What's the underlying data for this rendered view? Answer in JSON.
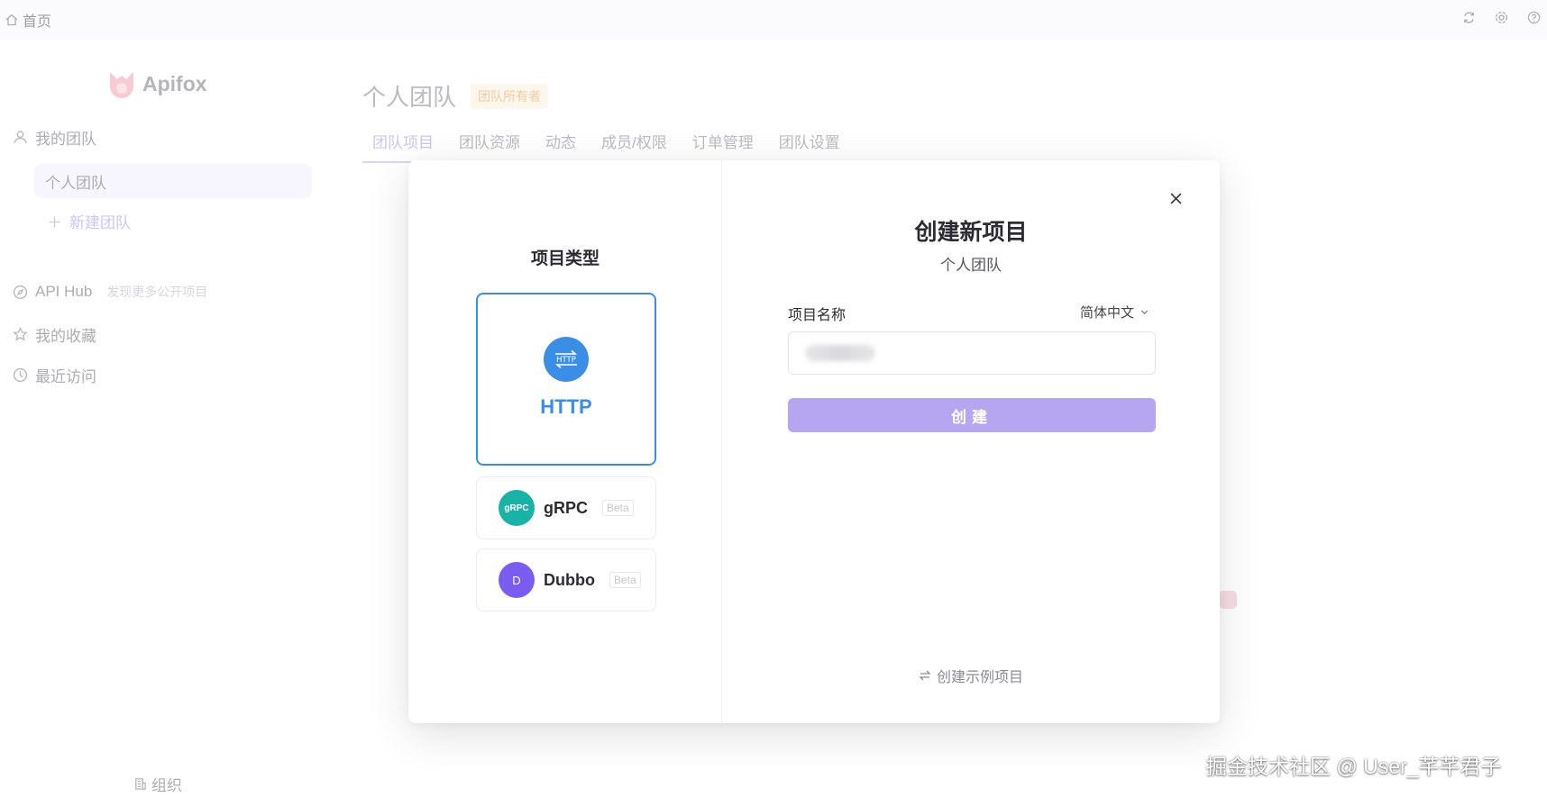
{
  "topbar": {
    "home_label": "首页",
    "icons": [
      "home-icon",
      "refresh-icon",
      "gear-icon",
      "help-icon"
    ]
  },
  "sidebar": {
    "logo_text": "Apifox",
    "my_team": "我的团队",
    "personal_team": "个人团队",
    "new_team": "新建团队",
    "api_hub": "API Hub",
    "api_hub_hint": "发现更多公开项目",
    "favorites": "我的收藏",
    "recent": "最近访问",
    "org": "组织"
  },
  "main": {
    "team_title": "个人团队",
    "owner_badge": "团队所有者",
    "tabs": [
      {
        "label": "团队项目",
        "active": true
      },
      {
        "label": "团队资源",
        "active": false
      },
      {
        "label": "动态",
        "active": false
      },
      {
        "label": "成员/权限",
        "active": false
      },
      {
        "label": "订单管理",
        "active": false
      },
      {
        "label": "团队设置",
        "active": false
      }
    ]
  },
  "modal": {
    "type_title": "项目类型",
    "types": [
      {
        "name": "HTTP",
        "icon_text": "HTTP",
        "selected": true
      },
      {
        "name": "gRPC",
        "icon_text": "gRPC",
        "beta": "Beta"
      },
      {
        "name": "Dubbo",
        "icon_text": "D",
        "beta": "Beta"
      }
    ],
    "title": "创建新项目",
    "subtitle": "个人团队",
    "name_label": "项目名称",
    "language": "简体中文",
    "name_value": "",
    "create_label": "创建",
    "example_link": "创建示例项目",
    "colors": {
      "accent": "#3a8ee6",
      "button": "#b6a6f2",
      "grpc": "#19b3a6",
      "dubbo": "#7b5cf0"
    }
  },
  "watermark": "掘金技术社区 @ User_芊芊君子"
}
